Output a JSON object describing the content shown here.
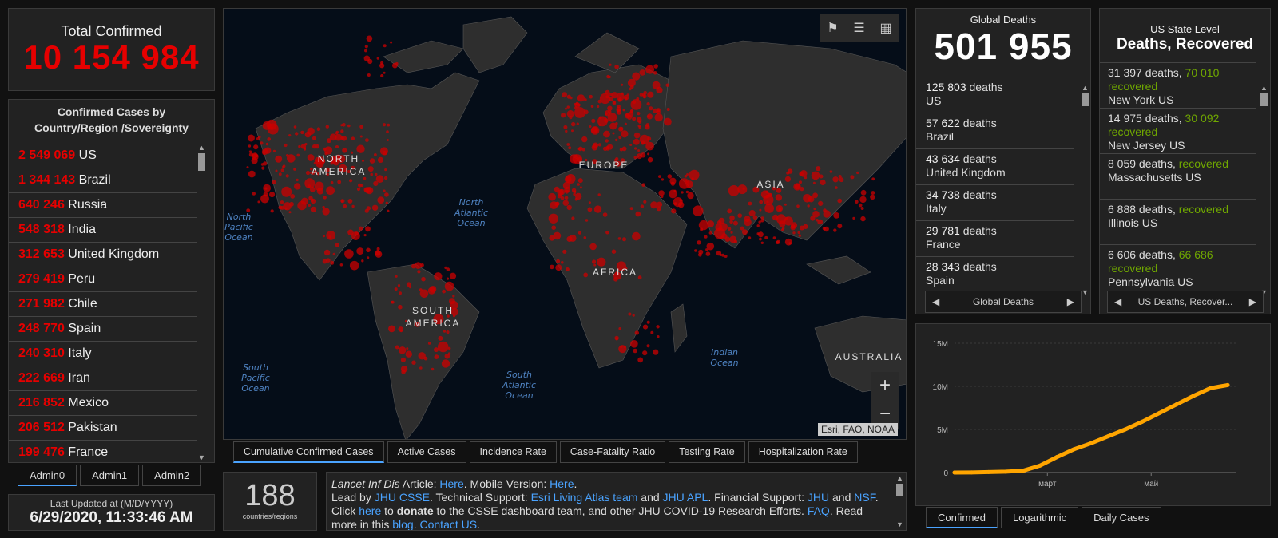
{
  "total_confirmed": {
    "title": "Total Confirmed",
    "value": "10 154 984"
  },
  "country_list": {
    "title": "Confirmed Cases by Country/Region /Sovereignty",
    "rows": [
      {
        "count": "2 549 069",
        "name": "US"
      },
      {
        "count": "1 344 143",
        "name": "Brazil"
      },
      {
        "count": "640 246",
        "name": "Russia"
      },
      {
        "count": "548 318",
        "name": "India"
      },
      {
        "count": "312 653",
        "name": "United Kingdom"
      },
      {
        "count": "279 419",
        "name": "Peru"
      },
      {
        "count": "271 982",
        "name": "Chile"
      },
      {
        "count": "248 770",
        "name": "Spain"
      },
      {
        "count": "240 310",
        "name": "Italy"
      },
      {
        "count": "222 669",
        "name": "Iran"
      },
      {
        "count": "216 852",
        "name": "Mexico"
      },
      {
        "count": "206 512",
        "name": "Pakistan"
      },
      {
        "count": "199 476",
        "name": "France"
      }
    ]
  },
  "admin_tabs": [
    "Admin0",
    "Admin1",
    "Admin2"
  ],
  "last_updated": {
    "label": "Last Updated at (M/D/YYYY)",
    "value": "6/29/2020, 11:33:46 AM"
  },
  "map": {
    "continents": [
      "NORTH AMERICA",
      "SOUTH AMERICA",
      "EUROPE",
      "AFRICA",
      "ASIA",
      "AUSTRALIA"
    ],
    "oceans": [
      "North Pacific Ocean",
      "North Atlantic Ocean",
      "South Pacific Ocean",
      "South Atlantic Ocean",
      "Indian Ocean"
    ],
    "attribution": "Esri, FAO, NOAA",
    "zoom_in": "+",
    "zoom_out": "−"
  },
  "map_tabs": [
    "Cumulative Confirmed Cases",
    "Active Cases",
    "Incidence Rate",
    "Case-Fatality Ratio",
    "Testing Rate",
    "Hospitalization Rate"
  ],
  "countries_count": {
    "value": "188",
    "label": "countries/regions"
  },
  "info": {
    "p1": "Lancet Inf Dis",
    "p2": " Article: ",
    "here1": "Here",
    "p3": ". Mobile Version: ",
    "here2": "Here",
    "p4": ".",
    "p5": "Lead by ",
    "jhucsse": "JHU CSSE",
    "p6": ". Technical Support: ",
    "esri": "Esri Living Atlas team",
    "p7": " and ",
    "jhuapl": "JHU APL",
    "p8": ". Financial Support: ",
    "jhu": "JHU",
    "p9": " and ",
    "nsf": "NSF",
    "p10": ". Click ",
    "here3": "here",
    "p11": " to ",
    "donate": "donate",
    "p12": " to the CSSE dashboard team, and other JHU COVID-19 Research Efforts. ",
    "faq": "FAQ",
    "p13": ". Read more in this ",
    "blog": "blog",
    "p14": ". ",
    "contact": "Contact US",
    "p15": "."
  },
  "global_deaths": {
    "title": "Global Deaths",
    "value": "501 955",
    "rows": [
      {
        "count": "125 803",
        "unit": "deaths",
        "name": "US"
      },
      {
        "count": "57 622",
        "unit": "deaths",
        "name": "Brazil"
      },
      {
        "count": "43 634",
        "unit": "deaths",
        "name": "United Kingdom"
      },
      {
        "count": "34 738",
        "unit": "deaths",
        "name": "Italy"
      },
      {
        "count": "29 781",
        "unit": "deaths",
        "name": "France"
      },
      {
        "count": "28 343",
        "unit": "deaths",
        "name": "Spain"
      }
    ],
    "nav_label": "Global Deaths"
  },
  "us_state": {
    "title": "US State Level",
    "subtitle": "Deaths, Recovered",
    "rows": [
      {
        "deaths": "31 397 deaths,",
        "recovered": "70 010",
        "rec_label": "recovered",
        "name": "New York US"
      },
      {
        "deaths": "14 975 deaths,",
        "recovered": "30 092",
        "rec_label": "recovered",
        "name": "New Jersey US"
      },
      {
        "deaths": "8 059 deaths,",
        "recovered": "",
        "rec_label": "recovered",
        "name": "Massachusetts US"
      },
      {
        "deaths": "6 888 deaths,",
        "recovered": "",
        "rec_label": "recovered",
        "name": "Illinois US"
      },
      {
        "deaths": "6 606 deaths,",
        "recovered": "66 686",
        "rec_label": "recovered",
        "name": "Pennsylvania US"
      }
    ],
    "nav_label": "US Deaths, Recover..."
  },
  "chart_tabs": [
    "Confirmed",
    "Logarithmic",
    "Daily Cases"
  ],
  "chart_data": {
    "type": "line",
    "yticks": [
      "15M",
      "10M",
      "5M",
      "0"
    ],
    "ylim": [
      0,
      15000000
    ],
    "xticks": [
      "март",
      "май"
    ],
    "color": "#ffa500",
    "x": [
      0,
      10,
      20,
      30,
      40,
      50,
      60,
      70,
      80,
      90,
      100,
      110,
      120,
      130,
      140,
      150,
      160
    ],
    "y": [
      0,
      10000,
      60000,
      100000,
      200000,
      800000,
      1800000,
      2700000,
      3400000,
      4200000,
      5000000,
      5900000,
      6900000,
      7900000,
      8900000,
      9800000,
      10150000
    ]
  }
}
